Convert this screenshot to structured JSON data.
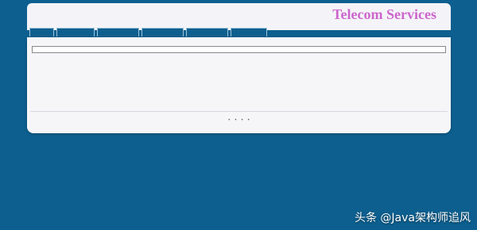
{
  "site": {
    "title": "Telecom Services"
  },
  "tabs": [
    {
      "label": ""
    },
    {
      "label": ""
    },
    {
      "label": ""
    },
    {
      "label": ""
    },
    {
      "label": ""
    },
    {
      "label": ""
    }
  ],
  "content": {
    "caption": "",
    "lines": [
      "",
      "",
      "",
      ""
    ]
  },
  "footer": {
    "prefix": "",
    "links": [
      "",
      "",
      "",
      "",
      ""
    ],
    "separator": "•"
  },
  "watermark": "头条 @Java架构师追风"
}
